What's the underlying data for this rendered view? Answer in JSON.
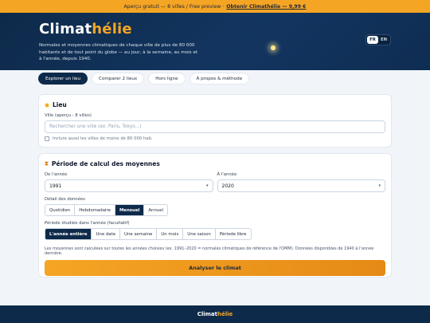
{
  "promo": {
    "text": "Aperçu gratuit — 8 villes / Free preview ·",
    "link": "Obtenir Climathélie — 9,99 €"
  },
  "hero": {
    "title_main": "Climat",
    "title_accent": "hélie",
    "description": "Normales et moyennes climatiques de chaque ville de plus de 80 000 habitants et de tout point du globe — au jour, à la semaine, au mois et à l'année, depuis 1940.",
    "lang": [
      "FR",
      "EN"
    ]
  },
  "tabs": [
    "Explorer un lieu",
    "Comparer 2 lieux",
    "Hors ligne",
    "À propos & méthode"
  ],
  "place": {
    "title": "Lieu",
    "city_label": "Ville (aperçu : 8 villes)",
    "city_placeholder": "Rechercher une ville (ex. Paris, Tokyo...)",
    "include_small": "Inclure aussi les villes de moins de 80 000 hab."
  },
  "period": {
    "title": "Période de calcul des moyennes",
    "from_label": "De l'année",
    "from_value": "1991",
    "to_label": "À l'année",
    "to_value": "2020",
    "detail_label": "Détail des données",
    "detail_options": [
      "Quotidien",
      "Hebdomadaire",
      "Mensuel",
      "Annuel"
    ],
    "detail_selected": "Mensuel",
    "range_label": "Période étudiée dans l'année (facultatif)",
    "range_options": [
      "L'année entière",
      "Une date",
      "Une semaine",
      "Un mois",
      "Une saison",
      "Période libre"
    ],
    "range_selected": "L'année entière",
    "note": "Les moyennes sont calculées sur toutes les années choisies (ex. 1991–2020 = normales climatiques de référence de l'OMM). Données disponibles de 1940 à l'année dernière.",
    "cta": "Analyser le climat"
  },
  "footer": {
    "main": "Climat",
    "accent": "hélie"
  }
}
